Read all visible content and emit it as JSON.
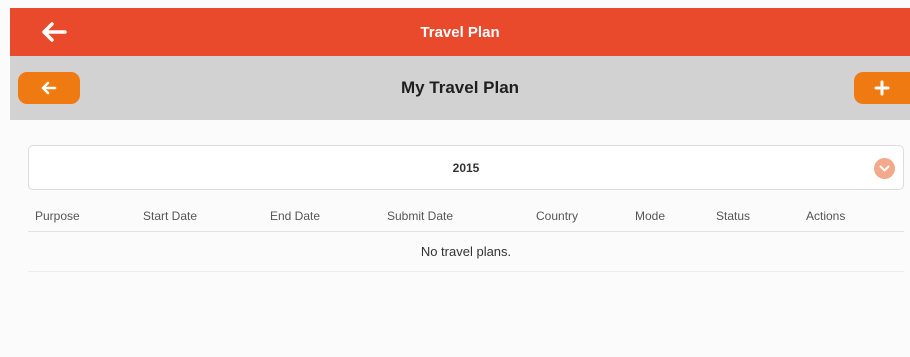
{
  "appbar": {
    "title": "Travel Plan",
    "back_icon": "arrow-left-icon"
  },
  "subheader": {
    "title": "My Travel Plan",
    "back_icon": "arrow-left-icon",
    "add_icon": "plus-icon"
  },
  "year_select": {
    "value": "2015",
    "icon": "chevron-down-icon"
  },
  "table": {
    "columns": [
      "Purpose",
      "Start Date",
      "End Date",
      "Submit Date",
      "Country",
      "Mode",
      "Status",
      "Actions"
    ],
    "empty_message": "No travel plans."
  },
  "colors": {
    "appbar": "#ea4a2c",
    "accent": "#f07a12",
    "subheader": "#d2d2d2",
    "chevron": "#f4a88c"
  }
}
